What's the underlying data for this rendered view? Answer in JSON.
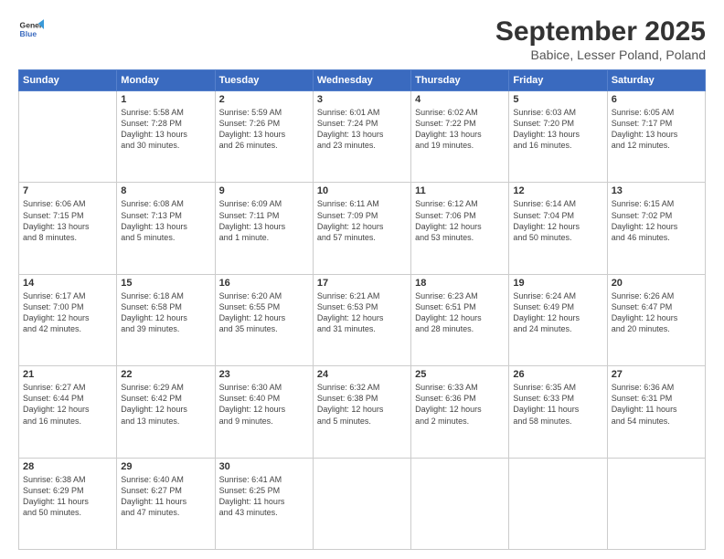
{
  "logo": {
    "line1": "General",
    "line2": "Blue"
  },
  "title": "September 2025",
  "subtitle": "Babice, Lesser Poland, Poland",
  "days_header": [
    "Sunday",
    "Monday",
    "Tuesday",
    "Wednesday",
    "Thursday",
    "Friday",
    "Saturday"
  ],
  "weeks": [
    [
      {
        "day": "",
        "info": ""
      },
      {
        "day": "1",
        "info": "Sunrise: 5:58 AM\nSunset: 7:28 PM\nDaylight: 13 hours\nand 30 minutes."
      },
      {
        "day": "2",
        "info": "Sunrise: 5:59 AM\nSunset: 7:26 PM\nDaylight: 13 hours\nand 26 minutes."
      },
      {
        "day": "3",
        "info": "Sunrise: 6:01 AM\nSunset: 7:24 PM\nDaylight: 13 hours\nand 23 minutes."
      },
      {
        "day": "4",
        "info": "Sunrise: 6:02 AM\nSunset: 7:22 PM\nDaylight: 13 hours\nand 19 minutes."
      },
      {
        "day": "5",
        "info": "Sunrise: 6:03 AM\nSunset: 7:20 PM\nDaylight: 13 hours\nand 16 minutes."
      },
      {
        "day": "6",
        "info": "Sunrise: 6:05 AM\nSunset: 7:17 PM\nDaylight: 13 hours\nand 12 minutes."
      }
    ],
    [
      {
        "day": "7",
        "info": "Sunrise: 6:06 AM\nSunset: 7:15 PM\nDaylight: 13 hours\nand 8 minutes."
      },
      {
        "day": "8",
        "info": "Sunrise: 6:08 AM\nSunset: 7:13 PM\nDaylight: 13 hours\nand 5 minutes."
      },
      {
        "day": "9",
        "info": "Sunrise: 6:09 AM\nSunset: 7:11 PM\nDaylight: 13 hours\nand 1 minute."
      },
      {
        "day": "10",
        "info": "Sunrise: 6:11 AM\nSunset: 7:09 PM\nDaylight: 12 hours\nand 57 minutes."
      },
      {
        "day": "11",
        "info": "Sunrise: 6:12 AM\nSunset: 7:06 PM\nDaylight: 12 hours\nand 53 minutes."
      },
      {
        "day": "12",
        "info": "Sunrise: 6:14 AM\nSunset: 7:04 PM\nDaylight: 12 hours\nand 50 minutes."
      },
      {
        "day": "13",
        "info": "Sunrise: 6:15 AM\nSunset: 7:02 PM\nDaylight: 12 hours\nand 46 minutes."
      }
    ],
    [
      {
        "day": "14",
        "info": "Sunrise: 6:17 AM\nSunset: 7:00 PM\nDaylight: 12 hours\nand 42 minutes."
      },
      {
        "day": "15",
        "info": "Sunrise: 6:18 AM\nSunset: 6:58 PM\nDaylight: 12 hours\nand 39 minutes."
      },
      {
        "day": "16",
        "info": "Sunrise: 6:20 AM\nSunset: 6:55 PM\nDaylight: 12 hours\nand 35 minutes."
      },
      {
        "day": "17",
        "info": "Sunrise: 6:21 AM\nSunset: 6:53 PM\nDaylight: 12 hours\nand 31 minutes."
      },
      {
        "day": "18",
        "info": "Sunrise: 6:23 AM\nSunset: 6:51 PM\nDaylight: 12 hours\nand 28 minutes."
      },
      {
        "day": "19",
        "info": "Sunrise: 6:24 AM\nSunset: 6:49 PM\nDaylight: 12 hours\nand 24 minutes."
      },
      {
        "day": "20",
        "info": "Sunrise: 6:26 AM\nSunset: 6:47 PM\nDaylight: 12 hours\nand 20 minutes."
      }
    ],
    [
      {
        "day": "21",
        "info": "Sunrise: 6:27 AM\nSunset: 6:44 PM\nDaylight: 12 hours\nand 16 minutes."
      },
      {
        "day": "22",
        "info": "Sunrise: 6:29 AM\nSunset: 6:42 PM\nDaylight: 12 hours\nand 13 minutes."
      },
      {
        "day": "23",
        "info": "Sunrise: 6:30 AM\nSunset: 6:40 PM\nDaylight: 12 hours\nand 9 minutes."
      },
      {
        "day": "24",
        "info": "Sunrise: 6:32 AM\nSunset: 6:38 PM\nDaylight: 12 hours\nand 5 minutes."
      },
      {
        "day": "25",
        "info": "Sunrise: 6:33 AM\nSunset: 6:36 PM\nDaylight: 12 hours\nand 2 minutes."
      },
      {
        "day": "26",
        "info": "Sunrise: 6:35 AM\nSunset: 6:33 PM\nDaylight: 11 hours\nand 58 minutes."
      },
      {
        "day": "27",
        "info": "Sunrise: 6:36 AM\nSunset: 6:31 PM\nDaylight: 11 hours\nand 54 minutes."
      }
    ],
    [
      {
        "day": "28",
        "info": "Sunrise: 6:38 AM\nSunset: 6:29 PM\nDaylight: 11 hours\nand 50 minutes."
      },
      {
        "day": "29",
        "info": "Sunrise: 6:40 AM\nSunset: 6:27 PM\nDaylight: 11 hours\nand 47 minutes."
      },
      {
        "day": "30",
        "info": "Sunrise: 6:41 AM\nSunset: 6:25 PM\nDaylight: 11 hours\nand 43 minutes."
      },
      {
        "day": "",
        "info": ""
      },
      {
        "day": "",
        "info": ""
      },
      {
        "day": "",
        "info": ""
      },
      {
        "day": "",
        "info": ""
      }
    ]
  ]
}
